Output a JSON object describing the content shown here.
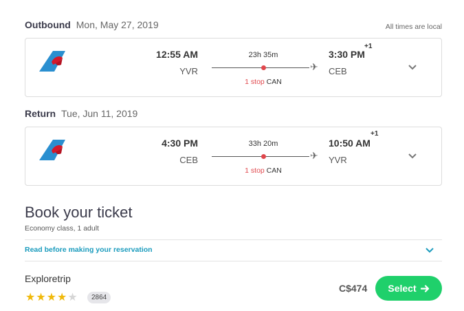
{
  "outbound": {
    "label": "Outbound",
    "date": "Mon, May 27, 2019",
    "times_note": "All times are local",
    "dep_time": "12:55 AM",
    "dep_code": "YVR",
    "arr_time": "3:30 PM",
    "arr_plus": "+1",
    "arr_code": "CEB",
    "duration": "23h 35m",
    "stop_count": "1 stop",
    "stop_code": "CAN"
  },
  "return": {
    "label": "Return",
    "date": "Tue, Jun 11, 2019",
    "dep_time": "4:30 PM",
    "dep_code": "CEB",
    "arr_time": "10:50 AM",
    "arr_plus": "+1",
    "arr_code": "YVR",
    "duration": "33h 20m",
    "stop_count": "1 stop",
    "stop_code": "CAN"
  },
  "booking": {
    "title": "Book your ticket",
    "subtitle": "Economy class, 1 adult",
    "read_link": "Read before making your reservation"
  },
  "offer": {
    "provider": "Exploretrip",
    "rating": 4,
    "rating_max": 5,
    "review_count": "2864",
    "price": "C$474",
    "select_label": "Select"
  },
  "colors": {
    "accent_green": "#1fd06b",
    "link_blue": "#1a9bbd",
    "stop_red": "#e0474c",
    "star_gold": "#f0b90b"
  },
  "icons": {
    "airline_logo": "china-southern-logo",
    "plane": "airplane-icon",
    "expand": "chevron-down-icon",
    "arrow": "arrow-right-icon",
    "star": "star-icon"
  }
}
